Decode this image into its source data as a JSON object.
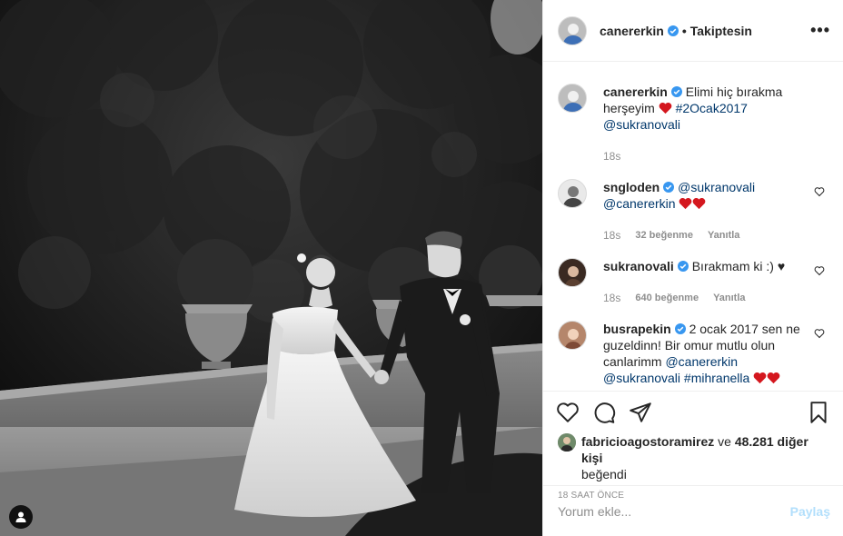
{
  "colors": {
    "text": "#262626",
    "secondary": "#8e8e8e",
    "link": "#00376b",
    "verified": "#3897f0",
    "heart": "#ed4956",
    "post_button_disabled": "#b2dffc",
    "border": "#efefef"
  },
  "post": {
    "photo_description_icon": "user-tag-icon"
  },
  "header": {
    "username": "canererkin",
    "separator": "•",
    "follow_state": "Takiptesin",
    "more": "•••"
  },
  "caption": {
    "username": "canererkin",
    "text_1": "Elimi hiç bırakma",
    "text_2": "herşeyim",
    "hashtag": "#2Ocak2017",
    "mention": "@sukranovali",
    "time": "18s"
  },
  "comments": [
    {
      "username": "sngloden",
      "mention_1": "@sukranovali",
      "mention_2": "@canererkin",
      "time": "18s",
      "likes": "32 beğenme",
      "reply": "Yanıtla"
    },
    {
      "username": "sukranovali",
      "text": "Bırakmam ki :) ♥",
      "time": "18s",
      "likes": "640 beğenme",
      "reply": "Yanıtla"
    },
    {
      "username": "busrapekin",
      "text_1": "2 ocak 2017 sen ne",
      "text_2": "guzeldinn! Bir omur mutlu olun",
      "text_3": "canlarimm",
      "mention_1": "@canererkin",
      "mention_2": "@sukranovali",
      "hashtag": "#mihranella"
    }
  ],
  "likes": {
    "first_liker": "fabricioagostoramirez",
    "connector": "ve",
    "others": "48.281 diğer kişi",
    "suffix": "beğendi"
  },
  "timestamp": "18 SAAT ÖNCE",
  "add_comment": {
    "placeholder": "Yorum ekle...",
    "post_label": "Paylaş"
  }
}
